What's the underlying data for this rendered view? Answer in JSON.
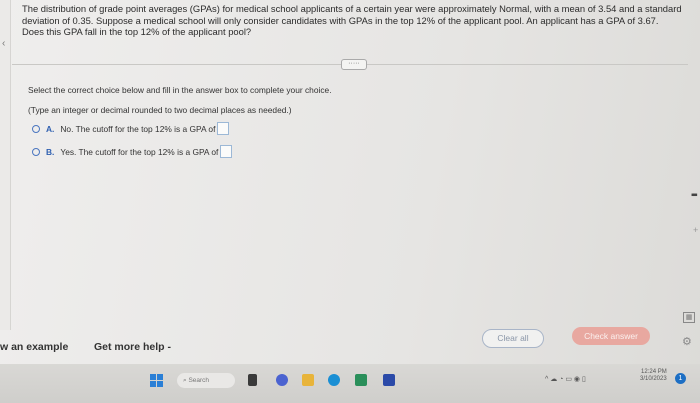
{
  "question": {
    "text": "The distribution of grade point averages (GPAs) for medical school applicants of a certain year were approximately Normal, with a mean of 3.54 and a standard deviation of 0.35. Suppose a medical school will only consider candidates with GPAs in the top 12% of the applicant pool. An applicant has a GPA of 3.67. Does this GPA fall in the top 12% of the applicant pool?"
  },
  "more_button": "·····",
  "instruction": "Select the correct choice below and fill in the answer box to complete your choice.",
  "note": "(Type an integer or decimal rounded to two decimal places as needed.)",
  "choices": [
    {
      "letter": "A.",
      "text": "No. The cutoff for the top 12% is a GPA of"
    },
    {
      "letter": "B.",
      "text": "Yes. The cutoff for the top 12% is a GPA of"
    }
  ],
  "footer": {
    "example_label": "w an example",
    "help_label": "Get more help -",
    "clear_label": "Clear all",
    "check_label": "Check answer"
  },
  "taskbar": {
    "search_placeholder": "Search",
    "time": "12:24 PM",
    "date": "3/10/2023"
  },
  "colors": {
    "accent": "#2f5fb0",
    "check_button": "#e8a8a0",
    "taskbar": "#d4d3d0"
  }
}
